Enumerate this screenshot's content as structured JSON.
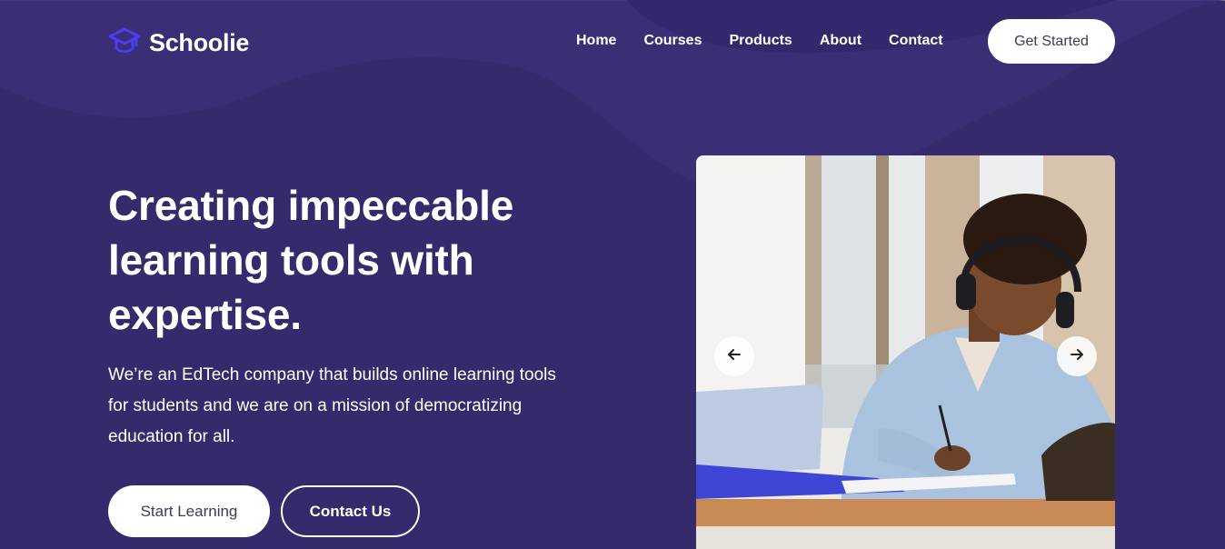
{
  "brand": {
    "name": "Schoolie",
    "icon": "graduation-cap-icon"
  },
  "nav": {
    "items": [
      {
        "label": "Home"
      },
      {
        "label": "Courses"
      },
      {
        "label": "Products"
      },
      {
        "label": "About"
      },
      {
        "label": "Contact"
      }
    ],
    "cta_label": "Get Started"
  },
  "hero": {
    "title": "Creating impeccable learning tools with expertise.",
    "description": "We’re an EdTech company that builds online learning tools for students and we are on a mission of democratizing education for all.",
    "primary_button": "Start Learning",
    "secondary_button": "Contact Us"
  },
  "carousel": {
    "prev_icon": "arrow-left-icon",
    "next_icon": "arrow-right-icon",
    "image_subject": "student-with-headphones-writing-at-desk"
  },
  "colors": {
    "background": "#352a6b",
    "accent_logo": "#4b3df2",
    "button_bg": "#ffffff",
    "button_text": "#3b3b55"
  }
}
